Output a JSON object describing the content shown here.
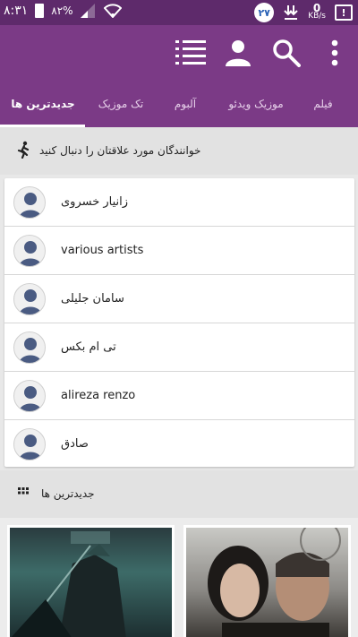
{
  "status_bar": {
    "time": "۸:۳۱",
    "battery": "۸۲%",
    "badge": "۲۷",
    "speed_value": "0",
    "speed_unit": "KB/s",
    "alert": "!"
  },
  "toolbar": {
    "icons": [
      "menu-list-icon",
      "account-icon",
      "search-icon",
      "overflow-menu-icon"
    ]
  },
  "tabs": [
    {
      "label": "فیلم"
    },
    {
      "label": "موزیک ویدئو"
    },
    {
      "label": "آلبوم"
    },
    {
      "label": "تک موزیک"
    },
    {
      "label": "جدیدترین ها",
      "active": true
    }
  ],
  "follow_bar": {
    "text": "خوانندگان مورد علاقتان را دنبال کنید"
  },
  "artists": [
    {
      "name": "زانیار خسروی"
    },
    {
      "name": "various artists"
    },
    {
      "name": "سامان جلیلی"
    },
    {
      "name": "تی ام بکس"
    },
    {
      "name": "alireza renzo"
    },
    {
      "name": "صادق"
    }
  ],
  "latest_section": {
    "title": "جدیدترین ها"
  },
  "colors": {
    "status_bar": "#5e2a6b",
    "toolbar": "#7b3a86",
    "tab_inactive_text": "#e6cfe9",
    "avatar_figure": "#4a5b82"
  }
}
